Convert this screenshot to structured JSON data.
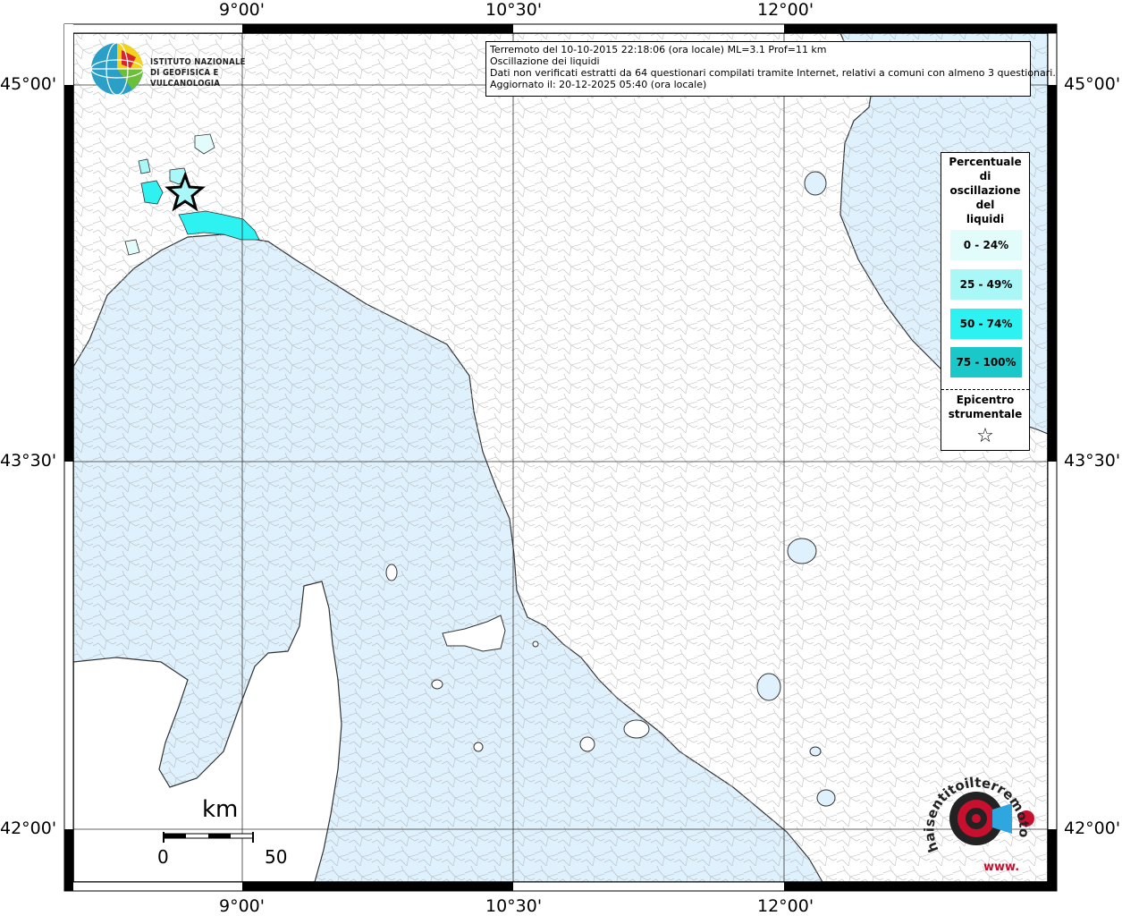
{
  "map": {
    "lon_labels": [
      "9°00'",
      "10°30'",
      "12°00'"
    ],
    "lat_labels": [
      "45°00'",
      "43°30'",
      "42°00'"
    ],
    "colors": {
      "sea": "#dff1fc",
      "land": "#ffffff",
      "border": "#666666"
    }
  },
  "info": {
    "line1": "Terremoto del 10-10-2015 22:18:06 (ora locale) ML=3.1 Prof=11 km",
    "line2": "Oscillazione dei liquidi",
    "line3": "Dati non verificati estratti da 64 questionari compilati tramite Internet, relativi a comuni con almeno 3 questionari.",
    "line4": "Aggiornato il: 20-12-2025 05:40 (ora locale)"
  },
  "logo": {
    "line1": "ISTITUTO NAZIONALE",
    "line2": "DI GEOFISICA E VULCANOLOGIA"
  },
  "legend": {
    "title_lines": [
      "Percentuale",
      "di",
      "oscillazione",
      "del",
      "liquidi"
    ],
    "classes": [
      {
        "label": "0 - 24%",
        "color": "#e2fcfc"
      },
      {
        "label": "25 - 49%",
        "color": "#a9f7f7"
      },
      {
        "label": "50 - 74%",
        "color": "#2ef1f2"
      },
      {
        "label": "75 - 100%",
        "color": "#1ac8c9"
      }
    ],
    "epicenter_line1": "Epicentro",
    "epicenter_line2": "strumentale",
    "epicenter_symbol": "☆"
  },
  "scale": {
    "unit": "km",
    "min": "0",
    "max": "50"
  },
  "watermark": {
    "text": "haisentitoilterremoto.it",
    "prefix": "www."
  }
}
